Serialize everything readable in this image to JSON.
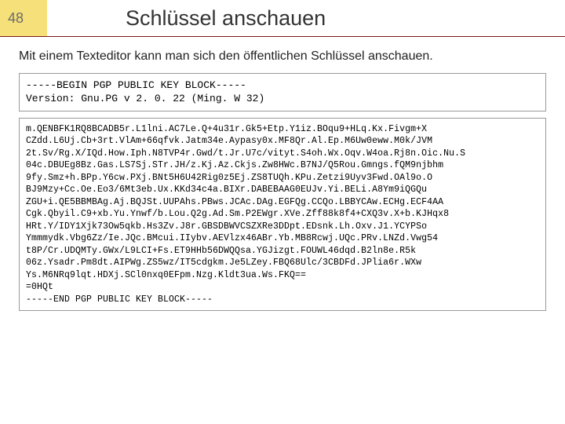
{
  "slide_number": "48",
  "title": "Schlüssel anschauen",
  "body_text": "Mit einem Texteditor kann man sich den öffentlichen Schlüssel anschauen.",
  "pgp_header": "-----BEGIN PGP PUBLIC KEY BLOCK-----\nVersion: Gnu.PG v 2. 0. 22 (Ming. W 32)",
  "pgp_body": "m.QENBFK1RQ8BCADB5r.L1lni.AC7Le.Q+4u31r.Gk5+Etp.Y1iz.BOqu9+HLq.Kx.Fivgm+X\nCZdd.L6Uj.Cb+3rt.VlAm+66qfvk.Jatm34e.Aypasy0x.MF8Qr.Al.Ep.M6Uw0eww.M0k/JVM\n2t.Sv/Rg.X/IQd.How.Iph.N8TVP4r.Gwd/t.Jr.U7c/vityt.S4oh.Wx.Oqv.W4oa.Rj8n.Oic.Nu.S\n04c.DBUEg8Bz.Gas.LS7Sj.STr.JH/z.Kj.Az.Ckjs.Zw8HWc.B7NJ/Q5Rou.Gmngs.fQM9njbhm\n9fy.Smz+h.BPp.Y6cw.PXj.BNt5H6U42Rig0z5Ej.ZS8TUQh.KPu.Zetzi9Uyv3Fwd.OAl9o.O\nBJ9Mzy+Cc.Oe.Eo3/6Mt3eb.Ux.KKd34c4a.BIXr.DABEBAAG0EUJv.Yi.BELi.A8Ym9iQGQu\nZGU+i.QE5BBMBAg.Aj.BQJSt.UUPAhs.PBws.JCAc.DAg.EGFQg.CCQo.LBBYCAw.ECHg.ECF4AA\nCgk.Qbyil.C9+xb.Yu.Ynwf/b.Lou.Q2g.Ad.Sm.P2EWgr.XVe.Zff88k8f4+CXQ3v.X+b.KJHqx8\nHRt.Y/IDY1Xjk73Ow5qkb.Hs3Zv.J8r.GBSDBWVCSZXRe3DDpt.EDsnk.Lh.Oxv.J1.YCYPSo\nYmmmydk.Vbg6Zz/Ie.JQc.BMcui.IIybv.AEVlzx46ABr.Yb.MB8Rcwj.UQc.PRv.LNZd.Vwg54\nt8P/Cr.UDQMTy.GWx/L9LCI+Fs.ET9HHb56DWQQsa.YGJizgt.FOUWL46dqd.B2ln8e.R5k\n06z.Ysadr.Pm8dt.AIPWg.ZS5wz/IT5cdgkm.Je5LZey.FBQ68Ulc/3CBDFd.JPlia6r.WXw\nYs.M6NRq9lqt.HDXj.SCl0nxq0EFpm.Nzg.Kldt3ua.Ws.FKQ==\n=0HQt\n-----END PGP PUBLIC KEY BLOCK-----"
}
